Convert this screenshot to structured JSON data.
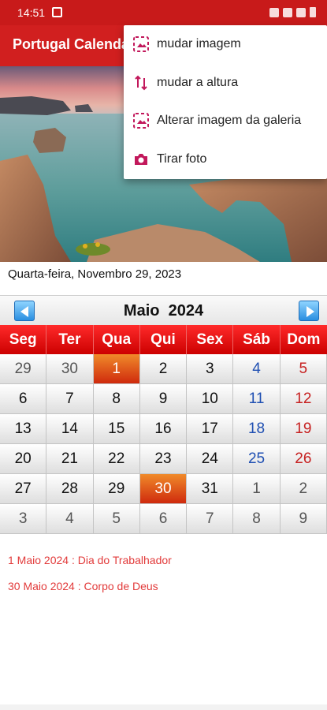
{
  "status": {
    "time": "14:51"
  },
  "app": {
    "title": "Portugal Calendário"
  },
  "current_date": "Quarta-feira, Novembro 29, 2023",
  "calendar": {
    "month_title": "Maio  2024",
    "weekdays": [
      "Seg",
      "Ter",
      "Qua",
      "Qui",
      "Sex",
      "Sáb",
      "Dom"
    ],
    "weeks": [
      [
        {
          "d": "29",
          "k": "other"
        },
        {
          "d": "30",
          "k": "other"
        },
        {
          "d": "1",
          "k": "holiday"
        },
        {
          "d": "2",
          "k": ""
        },
        {
          "d": "3",
          "k": ""
        },
        {
          "d": "4",
          "k": "sat"
        },
        {
          "d": "5",
          "k": "sun"
        }
      ],
      [
        {
          "d": "6",
          "k": ""
        },
        {
          "d": "7",
          "k": ""
        },
        {
          "d": "8",
          "k": ""
        },
        {
          "d": "9",
          "k": ""
        },
        {
          "d": "10",
          "k": ""
        },
        {
          "d": "11",
          "k": "sat"
        },
        {
          "d": "12",
          "k": "sun"
        }
      ],
      [
        {
          "d": "13",
          "k": ""
        },
        {
          "d": "14",
          "k": ""
        },
        {
          "d": "15",
          "k": ""
        },
        {
          "d": "16",
          "k": ""
        },
        {
          "d": "17",
          "k": ""
        },
        {
          "d": "18",
          "k": "sat"
        },
        {
          "d": "19",
          "k": "sun"
        }
      ],
      [
        {
          "d": "20",
          "k": ""
        },
        {
          "d": "21",
          "k": ""
        },
        {
          "d": "22",
          "k": ""
        },
        {
          "d": "23",
          "k": ""
        },
        {
          "d": "24",
          "k": ""
        },
        {
          "d": "25",
          "k": "sat"
        },
        {
          "d": "26",
          "k": "sun"
        }
      ],
      [
        {
          "d": "27",
          "k": ""
        },
        {
          "d": "28",
          "k": ""
        },
        {
          "d": "29",
          "k": ""
        },
        {
          "d": "30",
          "k": "holiday"
        },
        {
          "d": "31",
          "k": ""
        },
        {
          "d": "1",
          "k": "other"
        },
        {
          "d": "2",
          "k": "other"
        }
      ],
      [
        {
          "d": "3",
          "k": "other"
        },
        {
          "d": "4",
          "k": "other"
        },
        {
          "d": "5",
          "k": "other"
        },
        {
          "d": "6",
          "k": "other"
        },
        {
          "d": "7",
          "k": "other"
        },
        {
          "d": "8",
          "k": "other"
        },
        {
          "d": "9",
          "k": "other"
        }
      ]
    ]
  },
  "holidays": [
    "1 Maio 2024 : Dia do Trabalhador",
    "30 Maio 2024 : Corpo de Deus"
  ],
  "menu": {
    "items": [
      {
        "label": "mudar imagem",
        "icon": "image-icon"
      },
      {
        "label": "mudar a altura",
        "icon": "height-arrows-icon"
      },
      {
        "label": "Alterar imagem da galeria",
        "icon": "gallery-icon"
      },
      {
        "label": "Tirar foto",
        "icon": "camera-icon"
      }
    ]
  },
  "colors": {
    "accent": "#d11f1f",
    "saturday": "#1f4fb2",
    "sunday": "#c62020",
    "holiday_text": "#e23a3a"
  }
}
